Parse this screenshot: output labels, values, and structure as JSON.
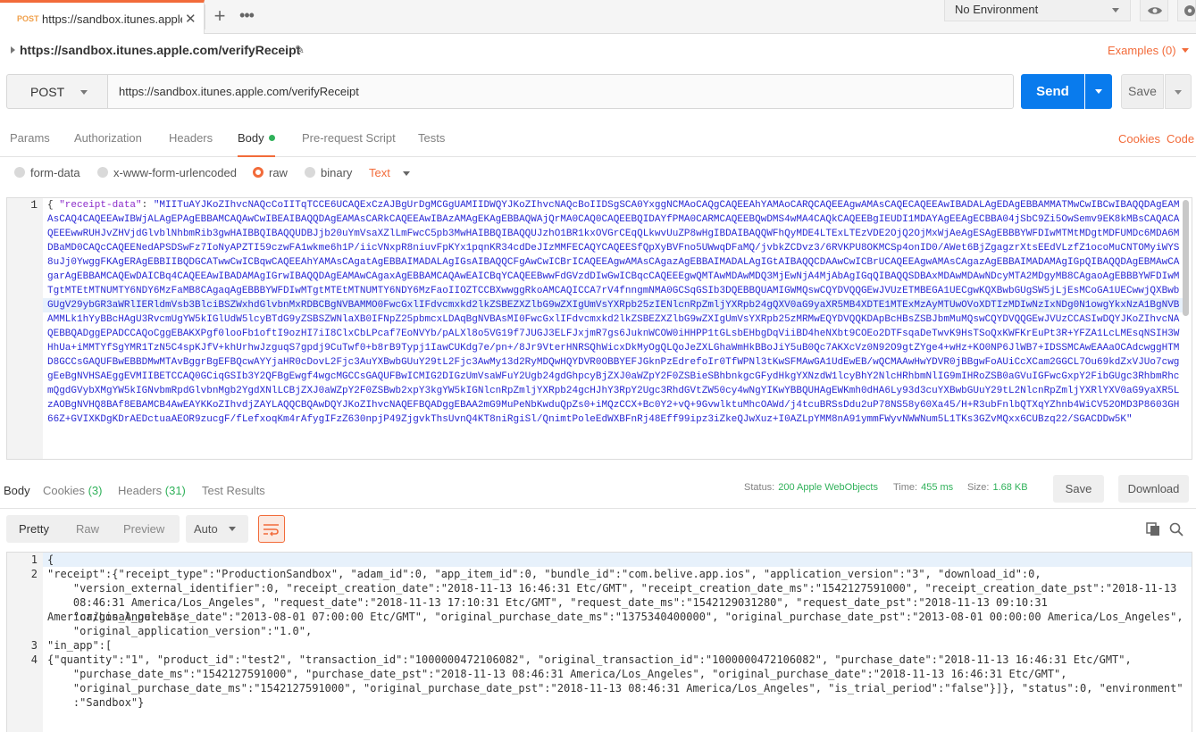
{
  "tabbar": {
    "tab_method": "POST",
    "tab_title": "https://sandbox.itunes.apple.c",
    "close_glyph": "✕",
    "add_glyph": "+",
    "more_glyph": "•••",
    "environment": "No Environment"
  },
  "request": {
    "title": "https://sandbox.itunes.apple.com/verifyReceipt",
    "examples": "Examples (0)",
    "method": "POST",
    "url": "https://sandbox.itunes.apple.com/verifyReceipt",
    "send_label": "Send",
    "save_label": "Save"
  },
  "req_tabs": {
    "params": "Params",
    "authorization": "Authorization",
    "headers": "Headers",
    "body": "Body",
    "prerequest": "Pre-request Script",
    "tests": "Tests",
    "cookies": "Cookies",
    "code": "Code"
  },
  "body_types": {
    "form_data": "form-data",
    "urlencoded": "x-www-form-urlencoded",
    "raw": "raw",
    "binary": "binary",
    "text_type": "Text"
  },
  "req_body": {
    "line_number": "1",
    "open": "{ ",
    "key": "\"receipt-data\"",
    "colon": ": ",
    "value": "\"MIITuAYJKoZIhvcNAQcCoIITqTCCE6UCAQExCzAJBgUrDgMCGgUAMIIDWQYJKoZIhvcNAQcBoIIDSgSCA0YxggNCMAoCAQgCAQEEAhYAMAoCARQCAQEEAgwAMAsCAQECAQEEAwIBADALAgEDAgEBBAMMATMwCwIBCwIBAQQDAgEAMAsCAQ4CAQEEAwIBWjALAgEPAgEBBAMCAQAwCwIBEAIBAQQDAgEAMAsCARkCAQEEAwIBAzAMAgEKAgEBBAQWAjQrMA0CAQ0CAQEEBQIDAYfPMA0CARMCAQEEBQwDMS4wMA4CAQkCAQEEBgIEUDI1MDAYAgEEAgECBBA04jSbC9Zi5OwSemv9EK8kMBsCAQACAQEEEwwRUHJvZHVjdGlvblNhbmRib3gwHAIBBQIBAQQUDBJjb20uYmVsaXZlLmFwcC5pb3MwHAIBBQIBAQQUJzhO1BR1kxOVGrCEqQLkwvUuZP8wHgIBDAIBAQQWFhQyMDE4LTExLTEzVDE2OjQ2OjMxWjAeAgESAgEBBBYWFDIwMTMtMDgtMDFUMDc6MDA6MDBaMD0CAQcCAQEENedAPSDSwFz7IoNyAPZTI59czwFA1wkme6h1P/iicVNxpR8niuvFpKYx1pqnKR34cdDeJIzMMFECAQYCAQEESfQpXyBVFno5UWwqDFaMQ/jvbkZCDvz3/6RVKPU8OKMCSp4onID0/AWet6BjZgagzrXtsEEdVLzfZ1ocoMuCNTOMyiWYS8uJj0YwggFKAgERAgEBBIIBQDGCATwwCwICBqwCAQEEAhYAMAsCAgatAgEBBAIMADALAgIGsAIBAQQCFgAwCwICBrICAQEEAgwAMAsCAgazAgEBBAIMADALAgIGtAIBAQQCDAAwCwICBrUCAQEEAgwAMAsCAgazAgEBBAIMADAMAgIGpQIBAQQDAgEBMAwCAgarAgEBBAMCAQEwDAICBq4CAQEEAwIBADAMAgIGrwIBAQQDAgEAMAwCAgaxAgEBBAMCAQAwEAICBqYCAQEEBwwFdGVzdDIwGwICBqcCAQEEEgwQMTAwMDAwMDQ3MjEwNjA4MjAbAgIGqQIBAQQSDBAxMDAwMDAwNDcyMTA2MDgyMB8CAgaoAgEBBBYWFDIwMTgtMTEtMTNUMTY6NDY6MzFaMB8CAgaqAgEBBBYWFDIwMTgtMTEtMTNUMTY6NDY6MzFaoIIOZTCCBXwwggRkoAMCAQICCA7rV4fnngmNMA0GCSqGSIb3DQEBBQUAMIGWMQswCQYDVQQGEwJVUzETMBEGA1UECgwKQXBwbGUgSW5jLjEsMCoGA1UECwwjQXBwbGUgV29ybGR3aWRlIERldmVsb3BlciBSZWxhdGlvbnMxRDBCBgNVBAMMO0FwcGxlIFdvcmxkd2lkZSBEZXZlbG9wZXIgUmVsYXRpb25zIENlcnRpZmljYXRpb24gQXV0aG9yaXR5MB4XDTE1MTExMzAyMTUwOVoXDTIzMDIwNzIxNDg0N1owgYkxNzA1BgNVBAMMLk1hYyBBcHAgU3RvcmUgYW5kIGlUdW5lcyBTdG9yZSBSZWNlaXB0IFNpZ25pbmcxLDAqBgNVBAsMI0FwcGxlIFdvcmxkd2lkZSBEZXZlbG9wZXIgUmVsYXRpb25zMRMwEQYDVQQKDApBcHBsZSBJbmMuMQswCQYDVQQGEwJVUzCCASIwDQYJKoZIhvcNAQEBBQADggEPADCCAQoCggEBAKXPgf0looFb1oftI9ozHI7iI8ClxCbLPcaf7EoNVYb/pALXl8o5VG19f7JUGJ3ELFJxjmR7gs6JuknWCOW0iHHPP1tGLsbEHbgDqViiBD4heNXbt9COEo2DTFsqaDeTwvK9HsTSoQxKWFKrEuPt3R+YFZA1LcLMEsqNSIH3WHhUa+iMMTYfSgYMR1TzN5C4spKJfV+khUrhwJzguqS7gpdj9CuTwf0+b8rB9Typj1IawCUKdg7e/pn+/8Jr9VterHNRSQhWicxDkMyOgQLQoJeZXLGhaWmHkBBoJiY5uB0Qc7AKXcVz0N92O9gtZYge4+wHz+KO0NP6JlWB7+IDSSMCAwEAAaOCAdcwggHTMD8GCCsGAQUFBwEBBDMwMTAvBggrBgEFBQcwAYYjaHR0cDovL2Fjc3AuYXBwbGUuY29tL2Fjc3AwMy13d2RyMDQwHQYDVR0OBBYEFJGknPzEdrefoIr0TfWPNl3tKwSFMAwGA1UdEwEB/wQCMAAwHwYDVR0jBBgwFoAUiCcXCam2GGCL7Ou69kdZxVJUo7cwggEeBgNVHSAEggEVMIIBETCCAQ0GCiqGSIb3Y2QFBgEwgf4wgcMGCCsGAQUFBwICMIG2DIGzUmVsaWFuY2Ugb24gdGhpcyBjZXJ0aWZpY2F0ZSBieSBhbnkgcGFydHkgYXNzdW1lcyBhY2NlcHRhbmNlIG9mIHRoZSB0aGVuIGFwcGxpY2FibGUgc3RhbmRhcmQgdGVybXMgYW5kIGNvbmRpdGlvbnMgb2YgdXNlLCBjZXJ0aWZpY2F0ZSBwb2xpY3kgYW5kIGNlcnRpZmljYXRpb24gcHJhY3RpY2Ugc3RhdGVtZW50cy4wNgYIKwYBBQUHAgEWKmh0dHA6Ly93d3cuYXBwbGUuY29tL2NlcnRpZmljYXRlYXV0aG9yaXR5LzAOBgNVHQ8BAf8EBAMCB4AwEAYKKoZIhvdjZAYLAQQCBQAwDQYJKoZIhvcNAQEFBQADggEBAA2mG9MuPeNbKwduQpZs0+iMQzCCX+Bc0Y2+vQ+9GvwlktuMhcOAWd/j4tcuBRSsDdu2uP78NS58y60Xa45/H+R3ubFnlbQTXqYZhnb4WiCV52OMD3P8603GH66Z+GVIXKDgKDrAEDctuaAEOR9zucgF/fLefxoqKm4rAfygIFzZ630npjP49ZjgvkThsUvnQ4KT8niRgiSl/QnimtPoleEdWXBFnRj48Eff99ipz3iZkeQJwXuz+I0AZLpYMM8nA91ymmFWyvNWWNum5L1TKs3GZvMQxx6CUBzq22/SGACDDw5K\""
  },
  "resp_tabs": {
    "body": "Body",
    "cookies": "Cookies",
    "cookies_count": "(3)",
    "headers": "Headers",
    "headers_count": "(31)",
    "test_results": "Test Results",
    "status_label": "Status:",
    "status_value": "200 Apple WebObjects",
    "time_label": "Time:",
    "time_value": "455 ms",
    "size_label": "Size:",
    "size_value": "1.68 KB",
    "save_label": "Save",
    "download_label": "Download"
  },
  "view": {
    "pretty": "Pretty",
    "raw": "Raw",
    "preview": "Preview",
    "format": "Auto"
  },
  "resp_body": {
    "line_numbers": [
      "1",
      "2",
      "3",
      "4"
    ],
    "lines": [
      "{",
      "\"receipt\":{\"receipt_type\":\"ProductionSandbox\", \"adam_id\":0, \"app_item_id\":0, \"bundle_id\":\"com.belive.app.ios\", \"application_version\":\"3\", \"download_id\":0,",
      "    \"version_external_identifier\":0, \"receipt_creation_date\":\"2018-11-13 16:46:31 Etc/GMT\", \"receipt_creation_date_ms\":\"1542127591000\", \"receipt_creation_date_pst\":\"2018-11-13",
      "    08:46:31 America/Los_Angeles\", \"request_date\":\"2018-11-13 17:10:31 Etc/GMT\", \"request_date_ms\":\"1542129031280\", \"request_date_pst\":\"2018-11-13 09:10:31 America/Los_Angeles\",",
      "    \"original_purchase_date\":\"2013-08-01 07:00:00 Etc/GMT\", \"original_purchase_date_ms\":\"1375340400000\", \"original_purchase_date_pst\":\"2013-08-01 00:00:00 America/Los_Angeles\",",
      "    \"original_application_version\":\"1.0\",",
      "\"in_app\":[",
      "{\"quantity\":\"1\", \"product_id\":\"test2\", \"transaction_id\":\"1000000472106082\", \"original_transaction_id\":\"1000000472106082\", \"purchase_date\":\"2018-11-13 16:46:31 Etc/GMT\",",
      "    \"purchase_date_ms\":\"1542127591000\", \"purchase_date_pst\":\"2018-11-13 08:46:31 America/Los_Angeles\", \"original_purchase_date\":\"2018-11-13 16:46:31 Etc/GMT\",",
      "    \"original_purchase_date_ms\":\"1542127591000\", \"original_purchase_date_pst\":\"2018-11-13 08:46:31 America/Los_Angeles\", \"is_trial_period\":\"false\"}]}, \"status\":0, \"environment\"",
      "    :\"Sandbox\"}"
    ]
  },
  "colors": {
    "accent": "#f26b3a",
    "send": "#097bed",
    "status_ok": "#30b15a"
  },
  "icons": [
    "close-icon",
    "plus-icon",
    "more-icon",
    "eye-icon",
    "gear-icon",
    "edit-icon",
    "wrap-icon",
    "copy-icon",
    "search-icon"
  ]
}
